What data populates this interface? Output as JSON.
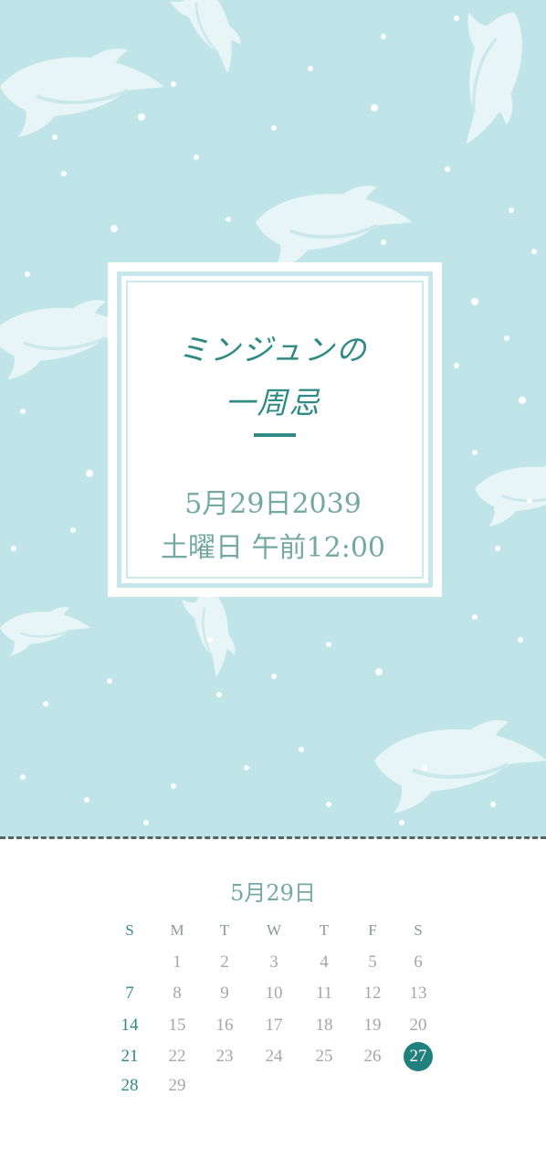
{
  "invitation": {
    "title_line1": "ミンジュンの",
    "title_line2": "一周忌",
    "date_line": "5月29日2039",
    "time_line": "土曜日 午前12:00"
  },
  "calendar": {
    "title": "5月29日",
    "weekdays": [
      "S",
      "M",
      "T",
      "W",
      "T",
      "F",
      "S"
    ],
    "weeks": [
      [
        "",
        "1",
        "2",
        "3",
        "4",
        "5",
        "6"
      ],
      [
        "7",
        "8",
        "9",
        "10",
        "11",
        "12",
        "13"
      ],
      [
        "14",
        "15",
        "16",
        "17",
        "18",
        "19",
        "20"
      ],
      [
        "21",
        "22",
        "23",
        "24",
        "25",
        "26",
        "27"
      ],
      [
        "28",
        "29",
        "",
        "",
        "",
        "",
        ""
      ]
    ],
    "selected_day": "27"
  },
  "colors": {
    "background": "#bfe5e8",
    "accent": "#2f8a86",
    "muted_text": "#74a9a2",
    "selected_day_fill": "#217f7d"
  },
  "icons": [
    "dolphin-pattern"
  ]
}
